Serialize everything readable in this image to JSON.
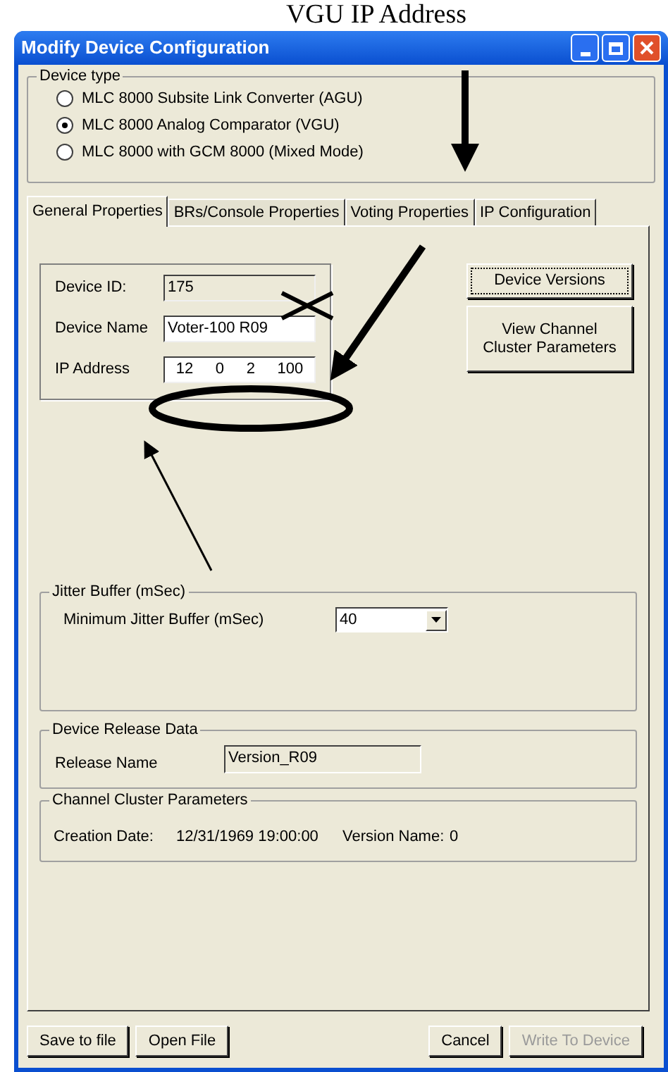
{
  "caption": "VGU IP Address",
  "window": {
    "title": "Modify Device Configuration"
  },
  "device_type": {
    "label": "Device type",
    "options": [
      {
        "label": "MLC 8000 Subsite Link Converter (AGU)",
        "selected": false
      },
      {
        "label": "MLC 8000 Analog Comparator (VGU)",
        "selected": true
      },
      {
        "label": "MLC 8000 with GCM 8000 (Mixed Mode)",
        "selected": false
      }
    ]
  },
  "tabs": [
    {
      "label": "General Properties",
      "selected": true
    },
    {
      "label": "BRs/Console Properties",
      "selected": false
    },
    {
      "label": "Voting Properties",
      "selected": false
    },
    {
      "label": "IP Configuration",
      "selected": false
    }
  ],
  "general": {
    "device_id": {
      "label": "Device ID:",
      "value": "175"
    },
    "device_name": {
      "label": "Device Name",
      "value": "Voter-100 R09"
    },
    "ip_address": {
      "label": "IP Address",
      "octets": [
        "12",
        "0",
        "2",
        "100"
      ]
    },
    "buttons": [
      "Device Versions",
      "View Channel Cluster Parameters"
    ]
  },
  "jitter_buffer": {
    "label": "Jitter Buffer (mSec)",
    "field_label": "Minimum Jitter Buffer (mSec)",
    "value": "40"
  },
  "release": {
    "label": "Device Release Data",
    "field_label": "Release Name",
    "value": "Version_R09"
  },
  "channel_cluster": {
    "label": "Channel Cluster Parameters",
    "creation_label": "Creation Date:",
    "creation_value": "12/31/1969 19:00:00",
    "version_label": "Version Name:",
    "version_value": "0"
  },
  "footer_buttons": [
    {
      "label": "Save to file",
      "disabled": false
    },
    {
      "label": "Open File",
      "disabled": false
    },
    {
      "label": "Cancel",
      "disabled": false
    },
    {
      "label": "Write To Device",
      "disabled": true
    }
  ]
}
